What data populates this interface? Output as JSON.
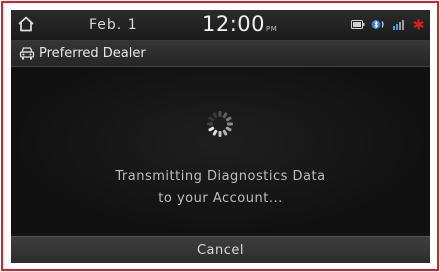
{
  "statusbar": {
    "date": "Feb.  1",
    "time": "12:00",
    "ampm": "PM",
    "icons": [
      "home-icon",
      "battery-icon",
      "bluetooth-icon",
      "signal-icon",
      "connectivity-star-icon"
    ]
  },
  "titlebar": {
    "icon": "car-icon",
    "title": "Preferred Dealer"
  },
  "content": {
    "icon": "loading-spinner-icon",
    "message_line1": "Transmitting Diagnostics Data",
    "message_line2": "to your Account..."
  },
  "actions": {
    "cancel_label": "Cancel"
  },
  "colors": {
    "frame_border": "#d81f26",
    "screen_bg": "#141414",
    "star_red": "#e02020"
  }
}
